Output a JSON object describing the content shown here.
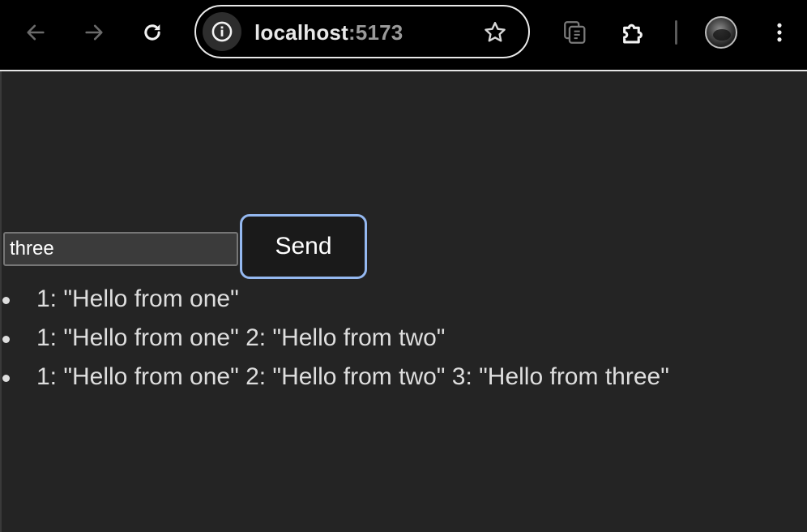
{
  "browser": {
    "url_host": "localhost",
    "url_port": ":5173",
    "icons": {
      "back": "arrow-left-icon",
      "forward": "arrow-right-icon",
      "reload": "reload-icon",
      "site_info": "info-icon",
      "bookmark": "star-icon",
      "tab_search": "tab-search-icon",
      "extensions": "puzzle-icon",
      "menu": "kebab-menu-icon"
    }
  },
  "form": {
    "input_value": "three",
    "send_label": "Send"
  },
  "messages": [
    "1: \"Hello from one\"",
    "1: \"Hello from one\" 2: \"Hello from two\"",
    "1: \"Hello from one\" 2: \"Hello from two\" 3: \"Hello from three\""
  ],
  "colors": {
    "page_background": "#242424",
    "toolbar_background": "#000000",
    "button_focus_ring": "#94b8f0"
  }
}
